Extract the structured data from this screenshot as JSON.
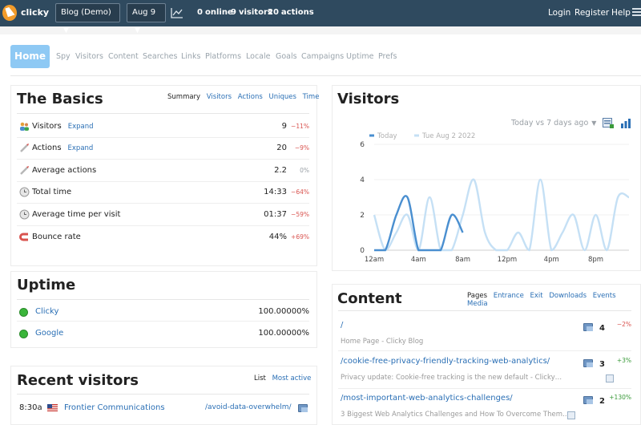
{
  "topbar": {
    "brand": "clicky",
    "site_selector": "Blog (Demo)",
    "date_selector": "Aug 9",
    "stats": [
      {
        "value": "0",
        "label": "online"
      },
      {
        "value": "9",
        "label": "visitors"
      },
      {
        "value": "20",
        "label": "actions"
      }
    ],
    "links": [
      "Login",
      "Register",
      "Help"
    ]
  },
  "nav": {
    "home": "Home",
    "items": [
      "Spy",
      "Visitors",
      "Content",
      "Searches",
      "Links",
      "Platforms",
      "Locale",
      "Goals",
      "Campaigns",
      "Uptime",
      "Prefs"
    ]
  },
  "basics": {
    "title": "The Basics",
    "tabs": [
      "Summary",
      "Visitors",
      "Actions",
      "Uniques",
      "Time"
    ],
    "rows": [
      {
        "label": "Visitors",
        "expand": "Expand",
        "value": "9",
        "change": "−11%",
        "icon": "visitors-icon"
      },
      {
        "label": "Actions",
        "expand": "Expand",
        "value": "20",
        "change": "−9%",
        "icon": "actions-icon"
      },
      {
        "label": "Average actions",
        "expand": "",
        "value": "2.2",
        "change": "0%",
        "icon": "average-actions-icon"
      },
      {
        "label": "Total time",
        "expand": "",
        "value": "14:33",
        "change": "−64%",
        "icon": "clock-icon"
      },
      {
        "label": "Average time per visit",
        "expand": "",
        "value": "01:37",
        "change": "−59%",
        "icon": "clock-icon"
      },
      {
        "label": "Bounce rate",
        "expand": "",
        "value": "44%",
        "change": "+69%",
        "icon": "bounce-icon"
      }
    ]
  },
  "uptime": {
    "title": "Uptime",
    "rows": [
      {
        "name": "Clicky",
        "value": "100.00000%"
      },
      {
        "name": "Google",
        "value": "100.00000%"
      }
    ]
  },
  "recent": {
    "title": "Recent visitors",
    "tabs": [
      "List",
      "Most active"
    ],
    "rows": [
      {
        "time": "8:30a",
        "org": "Frontier Communications",
        "path": "/avoid-data-overwhelm/"
      }
    ]
  },
  "visitors_panel": {
    "title": "Visitors",
    "compare_select": "Today vs 7 days ago"
  },
  "content": {
    "title": "Content",
    "tabs": [
      "Pages",
      "Entrance",
      "Exit",
      "Downloads",
      "Events",
      "Media"
    ],
    "rows": [
      {
        "path": "/",
        "desc": "Home Page - Clicky Blog",
        "count": "4",
        "change": "−2%"
      },
      {
        "path": "/cookie-free-privacy-friendly-tracking-web-analytics/",
        "desc": "Privacy update: Cookie-free tracking is the new default - Clicky…",
        "count": "3",
        "change": "+3%"
      },
      {
        "path": "/most-important-web-analytics-challenges/",
        "desc": "3 Biggest Web Analytics Challenges and How To Overcome Them…",
        "count": "2",
        "change": "+130%"
      }
    ]
  },
  "chart_data": {
    "type": "line",
    "title": "",
    "xlabel": "",
    "ylabel": "",
    "x": [
      "12am",
      "1am",
      "2am",
      "3am",
      "4am",
      "5am",
      "6am",
      "7am",
      "8am",
      "9am",
      "10am",
      "11am",
      "12pm",
      "1pm",
      "2pm",
      "3pm",
      "4pm",
      "5pm",
      "6pm",
      "7pm",
      "8pm",
      "9pm",
      "10pm",
      "11pm"
    ],
    "x_tick_labels": [
      "12am",
      "4am",
      "8am",
      "12pm",
      "4pm",
      "8pm"
    ],
    "ylim": [
      0,
      6
    ],
    "y_ticks": [
      0,
      2,
      4,
      6
    ],
    "legend_position": "top-left",
    "series": [
      {
        "name": "Today",
        "color": "#4a8fd0",
        "values": [
          0,
          0,
          2,
          3,
          0,
          0,
          0,
          2,
          1
        ]
      },
      {
        "name": "Tue Aug 2 2022",
        "color": "#c5e0f5",
        "values": [
          2,
          0,
          1,
          2,
          0,
          3,
          0,
          0,
          2,
          4,
          1,
          0,
          0,
          1,
          0,
          4,
          0,
          1,
          2,
          0,
          2,
          0,
          3,
          3
        ]
      }
    ]
  }
}
